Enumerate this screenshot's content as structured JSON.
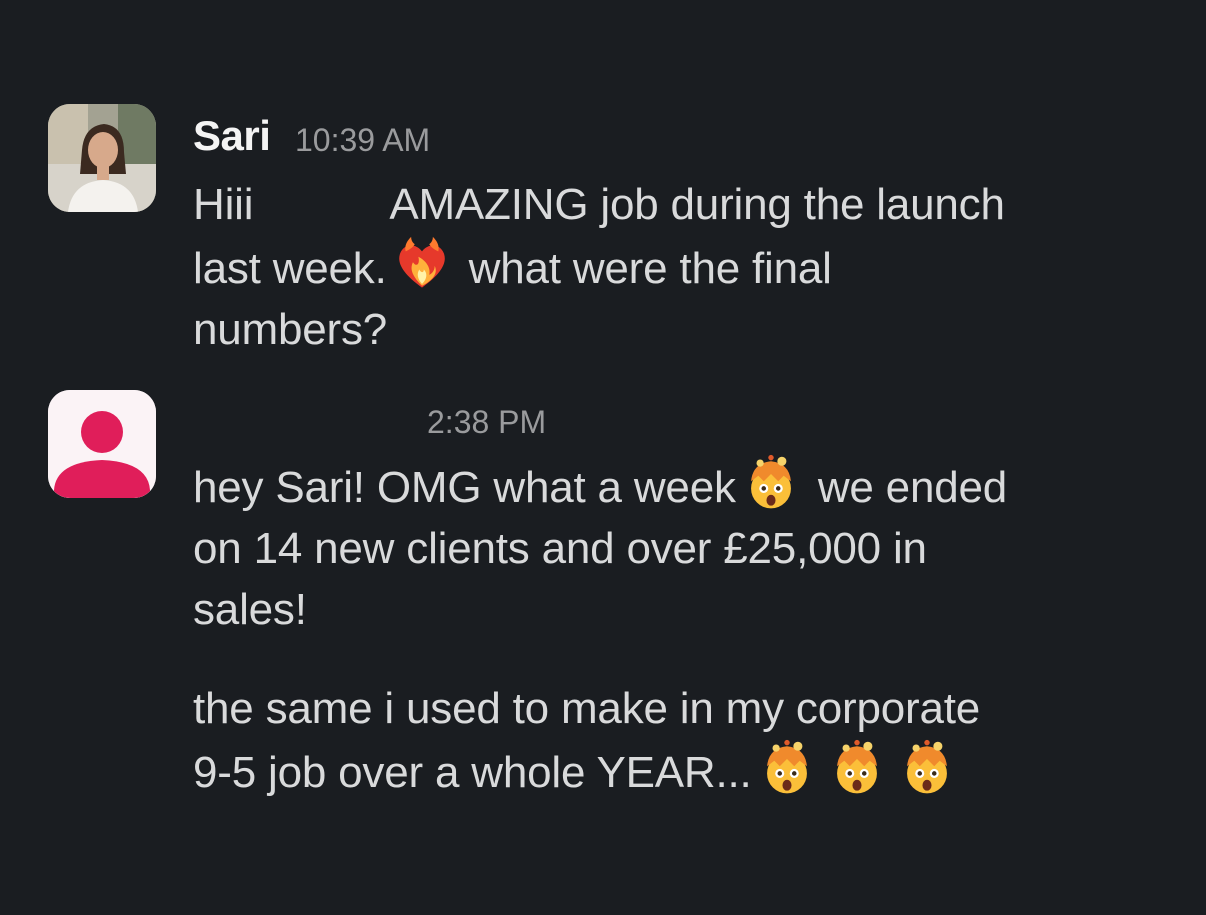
{
  "messages": [
    {
      "sender": "Sari",
      "time": "10:39 AM",
      "line1_a": "Hiii",
      "line1_b": "AMAZING job during the launch",
      "line2_a": "last week.",
      "line2_b": "what were the final",
      "line3": "numbers?",
      "emoji": "heart-on-fire-icon"
    },
    {
      "sender": "",
      "time": "2:38 PM",
      "p1_line1_a": "hey Sari! OMG what a week",
      "p1_line1_b": "we ended",
      "p1_line2": "on 14 new clients and over £25,000 in",
      "p1_line3": "sales!",
      "p2_line1": "the same i used to make in my corporate",
      "p2_line2": "9-5 job over a whole YEAR...",
      "emoji": "exploding-head-icon"
    }
  ],
  "colors": {
    "background": "#1a1d21",
    "text": "#d9dadb",
    "timestamp": "#9a9b9d",
    "avatar_accent": "#e01e5a"
  }
}
